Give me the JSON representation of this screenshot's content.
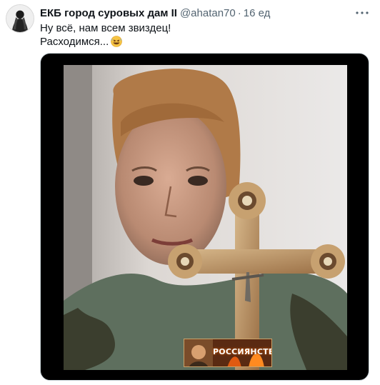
{
  "tweet": {
    "display_name": "ЕКБ город суровых дам II",
    "handle": "@ahatan70",
    "separator": "·",
    "time": "16 ед",
    "text_line1": "Ну всё, нам всем звиздец!",
    "text_line2": "Расходимся...",
    "emoji_icon": "rolling-on-floor-laughing-emoji"
  },
  "media": {
    "watermark_text": "РОССИЯНСТВО"
  },
  "colors": {
    "text": "#0f1419",
    "secondary": "#536471",
    "media_border": "#cfd9de"
  }
}
